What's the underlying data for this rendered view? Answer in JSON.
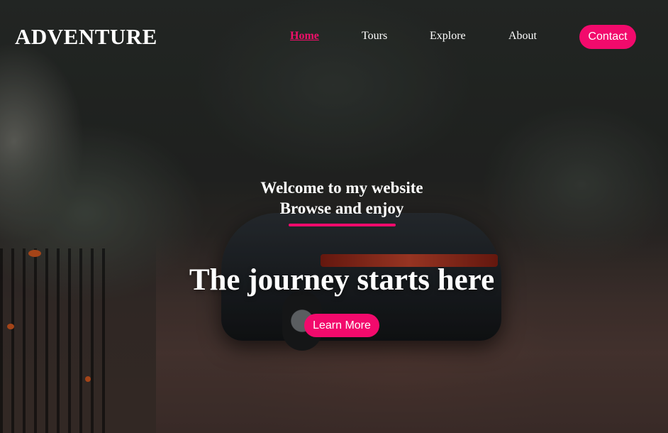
{
  "brand": {
    "name": "ADVENTURE"
  },
  "nav": {
    "items": [
      {
        "label": "Home",
        "active": true
      },
      {
        "label": "Tours",
        "active": false
      },
      {
        "label": "Explore",
        "active": false
      },
      {
        "label": "About",
        "active": false
      }
    ],
    "contact_label": "Contact"
  },
  "hero": {
    "welcome_line1": "Welcome to my website",
    "welcome_line2": "Browse and enjoy",
    "headline": "The journey starts here",
    "cta_label": "Learn More"
  },
  "colors": {
    "accent": "#f20a6c",
    "text": "#ffffff"
  },
  "background": {
    "image_description": "dark moody photo of a black sports car parked on a brick driveway among trees"
  }
}
